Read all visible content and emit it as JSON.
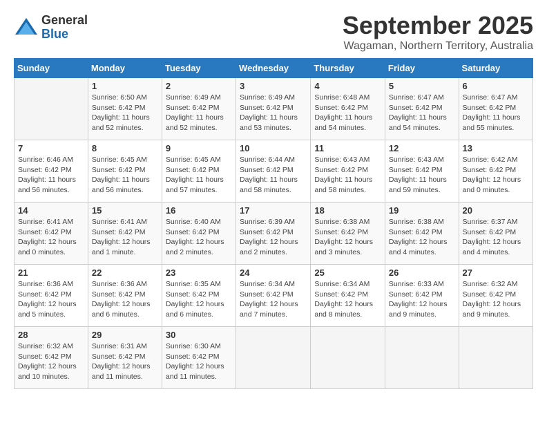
{
  "logo": {
    "general": "General",
    "blue": "Blue"
  },
  "title": "September 2025",
  "location": "Wagaman, Northern Territory, Australia",
  "weekdays": [
    "Sunday",
    "Monday",
    "Tuesday",
    "Wednesday",
    "Thursday",
    "Friday",
    "Saturday"
  ],
  "weeks": [
    [
      {
        "day": "",
        "info": ""
      },
      {
        "day": "1",
        "info": "Sunrise: 6:50 AM\nSunset: 6:42 PM\nDaylight: 11 hours\nand 52 minutes."
      },
      {
        "day": "2",
        "info": "Sunrise: 6:49 AM\nSunset: 6:42 PM\nDaylight: 11 hours\nand 52 minutes."
      },
      {
        "day": "3",
        "info": "Sunrise: 6:49 AM\nSunset: 6:42 PM\nDaylight: 11 hours\nand 53 minutes."
      },
      {
        "day": "4",
        "info": "Sunrise: 6:48 AM\nSunset: 6:42 PM\nDaylight: 11 hours\nand 54 minutes."
      },
      {
        "day": "5",
        "info": "Sunrise: 6:47 AM\nSunset: 6:42 PM\nDaylight: 11 hours\nand 54 minutes."
      },
      {
        "day": "6",
        "info": "Sunrise: 6:47 AM\nSunset: 6:42 PM\nDaylight: 11 hours\nand 55 minutes."
      }
    ],
    [
      {
        "day": "7",
        "info": "Sunrise: 6:46 AM\nSunset: 6:42 PM\nDaylight: 11 hours\nand 56 minutes."
      },
      {
        "day": "8",
        "info": "Sunrise: 6:45 AM\nSunset: 6:42 PM\nDaylight: 11 hours\nand 56 minutes."
      },
      {
        "day": "9",
        "info": "Sunrise: 6:45 AM\nSunset: 6:42 PM\nDaylight: 11 hours\nand 57 minutes."
      },
      {
        "day": "10",
        "info": "Sunrise: 6:44 AM\nSunset: 6:42 PM\nDaylight: 11 hours\nand 58 minutes."
      },
      {
        "day": "11",
        "info": "Sunrise: 6:43 AM\nSunset: 6:42 PM\nDaylight: 11 hours\nand 58 minutes."
      },
      {
        "day": "12",
        "info": "Sunrise: 6:43 AM\nSunset: 6:42 PM\nDaylight: 11 hours\nand 59 minutes."
      },
      {
        "day": "13",
        "info": "Sunrise: 6:42 AM\nSunset: 6:42 PM\nDaylight: 12 hours\nand 0 minutes."
      }
    ],
    [
      {
        "day": "14",
        "info": "Sunrise: 6:41 AM\nSunset: 6:42 PM\nDaylight: 12 hours\nand 0 minutes."
      },
      {
        "day": "15",
        "info": "Sunrise: 6:41 AM\nSunset: 6:42 PM\nDaylight: 12 hours\nand 1 minute."
      },
      {
        "day": "16",
        "info": "Sunrise: 6:40 AM\nSunset: 6:42 PM\nDaylight: 12 hours\nand 2 minutes."
      },
      {
        "day": "17",
        "info": "Sunrise: 6:39 AM\nSunset: 6:42 PM\nDaylight: 12 hours\nand 2 minutes."
      },
      {
        "day": "18",
        "info": "Sunrise: 6:38 AM\nSunset: 6:42 PM\nDaylight: 12 hours\nand 3 minutes."
      },
      {
        "day": "19",
        "info": "Sunrise: 6:38 AM\nSunset: 6:42 PM\nDaylight: 12 hours\nand 4 minutes."
      },
      {
        "day": "20",
        "info": "Sunrise: 6:37 AM\nSunset: 6:42 PM\nDaylight: 12 hours\nand 4 minutes."
      }
    ],
    [
      {
        "day": "21",
        "info": "Sunrise: 6:36 AM\nSunset: 6:42 PM\nDaylight: 12 hours\nand 5 minutes."
      },
      {
        "day": "22",
        "info": "Sunrise: 6:36 AM\nSunset: 6:42 PM\nDaylight: 12 hours\nand 6 minutes."
      },
      {
        "day": "23",
        "info": "Sunrise: 6:35 AM\nSunset: 6:42 PM\nDaylight: 12 hours\nand 6 minutes."
      },
      {
        "day": "24",
        "info": "Sunrise: 6:34 AM\nSunset: 6:42 PM\nDaylight: 12 hours\nand 7 minutes."
      },
      {
        "day": "25",
        "info": "Sunrise: 6:34 AM\nSunset: 6:42 PM\nDaylight: 12 hours\nand 8 minutes."
      },
      {
        "day": "26",
        "info": "Sunrise: 6:33 AM\nSunset: 6:42 PM\nDaylight: 12 hours\nand 9 minutes."
      },
      {
        "day": "27",
        "info": "Sunrise: 6:32 AM\nSunset: 6:42 PM\nDaylight: 12 hours\nand 9 minutes."
      }
    ],
    [
      {
        "day": "28",
        "info": "Sunrise: 6:32 AM\nSunset: 6:42 PM\nDaylight: 12 hours\nand 10 minutes."
      },
      {
        "day": "29",
        "info": "Sunrise: 6:31 AM\nSunset: 6:42 PM\nDaylight: 12 hours\nand 11 minutes."
      },
      {
        "day": "30",
        "info": "Sunrise: 6:30 AM\nSunset: 6:42 PM\nDaylight: 12 hours\nand 11 minutes."
      },
      {
        "day": "",
        "info": ""
      },
      {
        "day": "",
        "info": ""
      },
      {
        "day": "",
        "info": ""
      },
      {
        "day": "",
        "info": ""
      }
    ]
  ]
}
